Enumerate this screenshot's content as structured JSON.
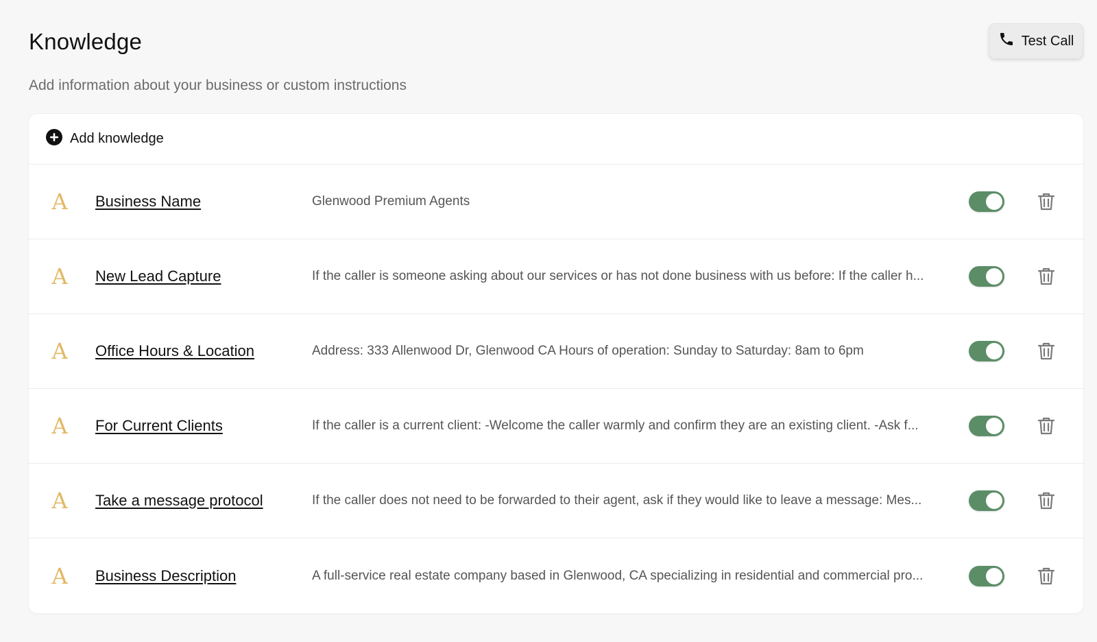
{
  "header": {
    "title": "Knowledge",
    "subtitle": "Add information about your business or custom instructions",
    "test_call_label": "Test Call"
  },
  "colors": {
    "toggle_on": "#5b8d67",
    "icon_accent": "#e2b866"
  },
  "add_knowledge": {
    "label": "Add knowledge",
    "icon": "plus-circle-icon"
  },
  "items": [
    {
      "icon": "A",
      "name": "Business Name",
      "content": "Glenwood Premium Agents",
      "enabled": true
    },
    {
      "icon": "A",
      "name": "New Lead Capture",
      "content": "If the caller is someone asking about our services or has not done business with us before: If the caller h...",
      "enabled": true
    },
    {
      "icon": "A",
      "name": "Office Hours & Location",
      "content": "Address: 333 Allenwood Dr, Glenwood CA Hours of operation: Sunday to Saturday: 8am to 6pm",
      "enabled": true
    },
    {
      "icon": "A",
      "name": "For Current Clients",
      "content": "If the caller is a current client: -Welcome the caller warmly and confirm they are an existing client. -Ask f...",
      "enabled": true
    },
    {
      "icon": "A",
      "name": "Take a message protocol",
      "content": "If the caller does not need to be forwarded to their agent, ask if they would like to leave a message: Mes...",
      "enabled": true
    },
    {
      "icon": "A",
      "name": "Business Description",
      "content": "A full-service real estate company based in Glenwood, CA specializing in residential and commercial pro...",
      "enabled": true
    }
  ]
}
